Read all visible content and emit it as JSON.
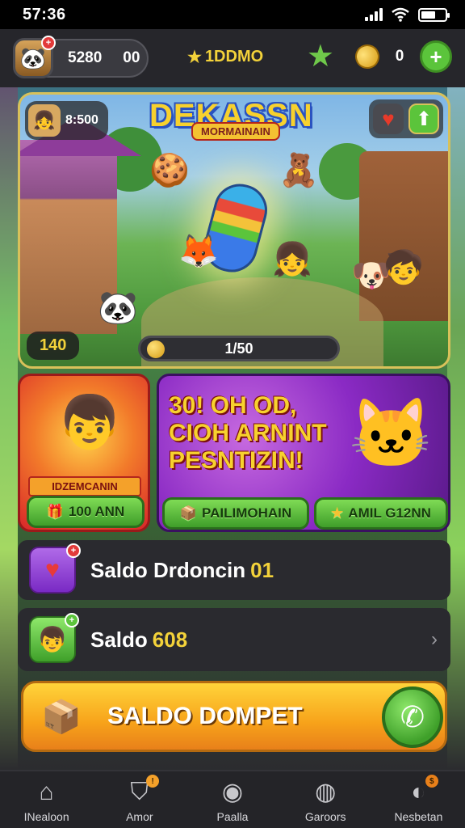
{
  "status_bar": {
    "time": "57:36"
  },
  "topbar": {
    "stat_a": "5280",
    "stat_b": "00",
    "center_label": "1DDMO",
    "coin_count": "0",
    "profile_notif": "+",
    "add_symbol": "+"
  },
  "banner": {
    "title": "DEKASSN",
    "subtitle": "MORMAINAIN",
    "score": "8:500",
    "level": "140",
    "progress_value": "1/50"
  },
  "promo_left": {
    "ribbon": "IDZEMCANIN",
    "button": "100 ANN"
  },
  "promo_right": {
    "headline": "30! OH OD, CIOH ARNINT PESNTIZIN!",
    "button_a": "PAILIMOHAIN",
    "button_b": "AMIL G12NN"
  },
  "rows": [
    {
      "label": "Saldo Drdoncin",
      "value": "01"
    },
    {
      "label": "Saldo",
      "value": "608"
    }
  ],
  "cta": {
    "label": "SALDO DOMPET"
  },
  "bottom_nav": [
    {
      "label": "INealoon",
      "icon": "home-icon"
    },
    {
      "label": "Amor",
      "icon": "shield-icon"
    },
    {
      "label": "Paalla",
      "icon": "game-icon"
    },
    {
      "label": "Garoors",
      "icon": "globe-icon"
    },
    {
      "label": "Nesbetan",
      "icon": "profile-icon"
    }
  ],
  "colors": {
    "accent_yellow": "#f3d23a",
    "accent_green": "#5bc43b",
    "cta_orange": "#f7a21a",
    "bg_dark": "#1c1c20"
  }
}
